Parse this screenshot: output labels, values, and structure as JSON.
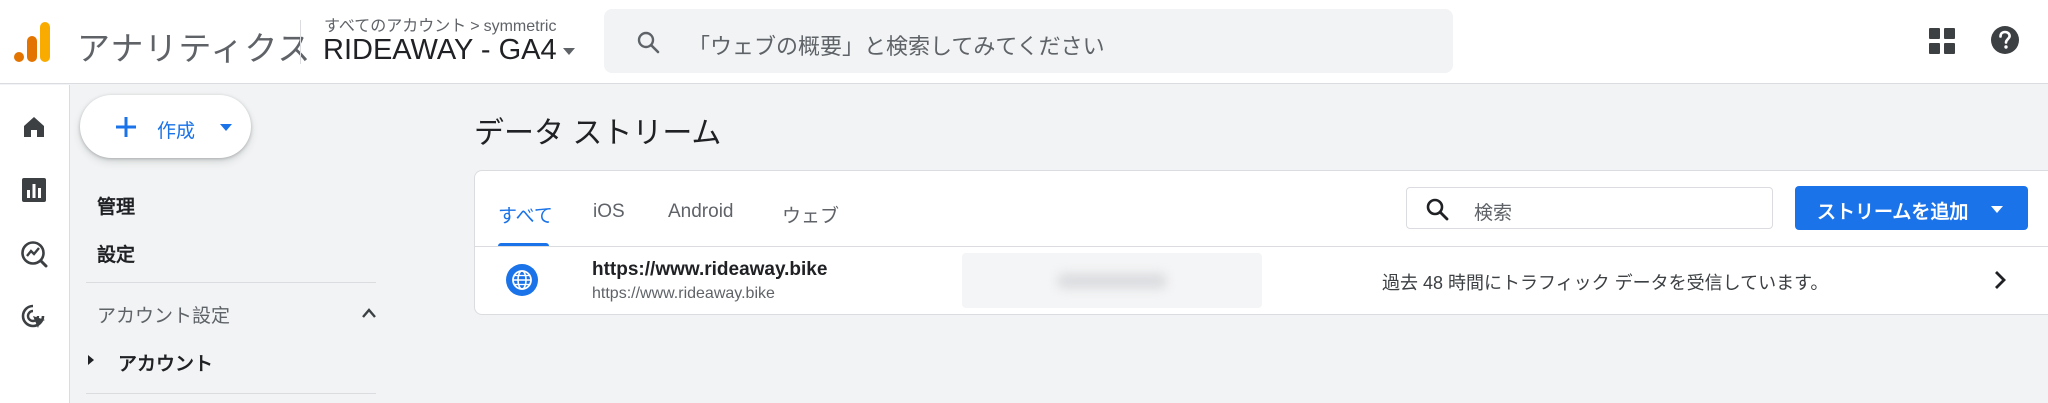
{
  "header": {
    "app_title": "アナリティクス",
    "breadcrumb_all_accounts": "すべてのアカウント",
    "breadcrumb_separator": ">",
    "breadcrumb_account": "symmetric",
    "property_name": "RIDEAWAY - GA4",
    "search_placeholder": "「ウェブの概要」と検索してみてください",
    "icons": [
      "analytics-logo",
      "search-icon",
      "apps-grid-icon",
      "help-icon"
    ]
  },
  "rail": {
    "icons": [
      "home-icon",
      "reports-icon",
      "explore-icon",
      "advertising-icon"
    ]
  },
  "sidebar": {
    "create_label": "作成",
    "admin_label": "管理",
    "settings_label": "設定",
    "account_settings_label": "アカウント設定",
    "account_label": "アカウント"
  },
  "main": {
    "page_title": "データ ストリーム",
    "tabs": [
      {
        "label": "すべて",
        "active": true
      },
      {
        "label": "iOS",
        "active": false
      },
      {
        "label": "Android",
        "active": false
      },
      {
        "label": "ウェブ",
        "active": false
      }
    ],
    "search_placeholder": "検索",
    "add_stream_label": "ストリームを追加",
    "streams": [
      {
        "name": "https://www.rideaway.bike",
        "url": "https://www.rideaway.bike",
        "status": "過去 48 時間にトラフィック データを受信しています。"
      }
    ]
  },
  "colors": {
    "accent_blue": "#1a73e8",
    "logo_orange": "#f9ab00",
    "logo_dark_orange": "#e37400"
  }
}
